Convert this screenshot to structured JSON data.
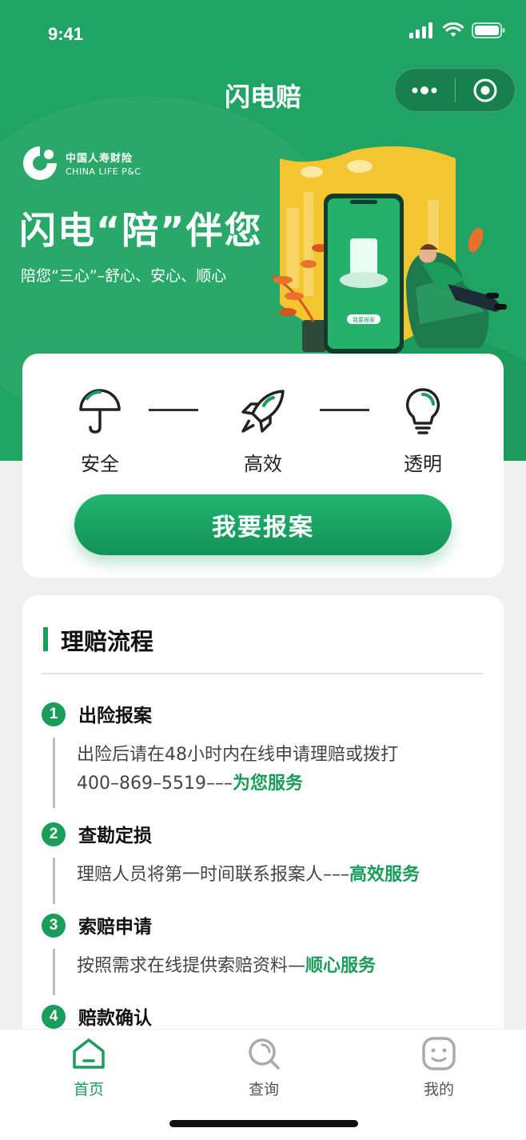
{
  "status_bar": {
    "time": "9:41"
  },
  "nav": {
    "title": "闪电赔"
  },
  "hero": {
    "brand_cn": "中国人寿财险",
    "brand_en": "CHINA LIFE P&C",
    "slogan": "闪电“陪”伴您",
    "subslogan": "陪您“三心”–舒心、安心、顺心",
    "phone_button_text": "我要报案"
  },
  "features": [
    {
      "label": "安全",
      "icon": "umbrella-icon"
    },
    {
      "label": "高效",
      "icon": "rocket-icon"
    },
    {
      "label": "透明",
      "icon": "bulb-icon"
    }
  ],
  "report_button": "我要报案",
  "process": {
    "title": "理赔流程",
    "steps": [
      {
        "num": "1",
        "title": "出险报案",
        "desc_line1": "出险后请在48小时内在线申请理赔或拨打",
        "desc_line2": "400–869–5519–––",
        "highlight": "为您服务"
      },
      {
        "num": "2",
        "title": "查勘定损",
        "desc": "理赔人员将第一时间联系报案人–––",
        "highlight": "高效服务"
      },
      {
        "num": "3",
        "title": "索赔申请",
        "desc": "按照需求在线提供索赔资料—",
        "highlight": "顺心服务"
      },
      {
        "num": "4",
        "title": "赔款确认"
      }
    ]
  },
  "tabbar": {
    "items": [
      {
        "label": "首页",
        "icon": "home-icon",
        "active": true
      },
      {
        "label": "查询",
        "icon": "search-icon",
        "active": false
      },
      {
        "label": "我的",
        "icon": "profile-face-icon",
        "active": false
      }
    ]
  },
  "colors": {
    "brand_green": "#1fa463",
    "accent_green": "#1a9c5b",
    "inactive": "#999999"
  }
}
